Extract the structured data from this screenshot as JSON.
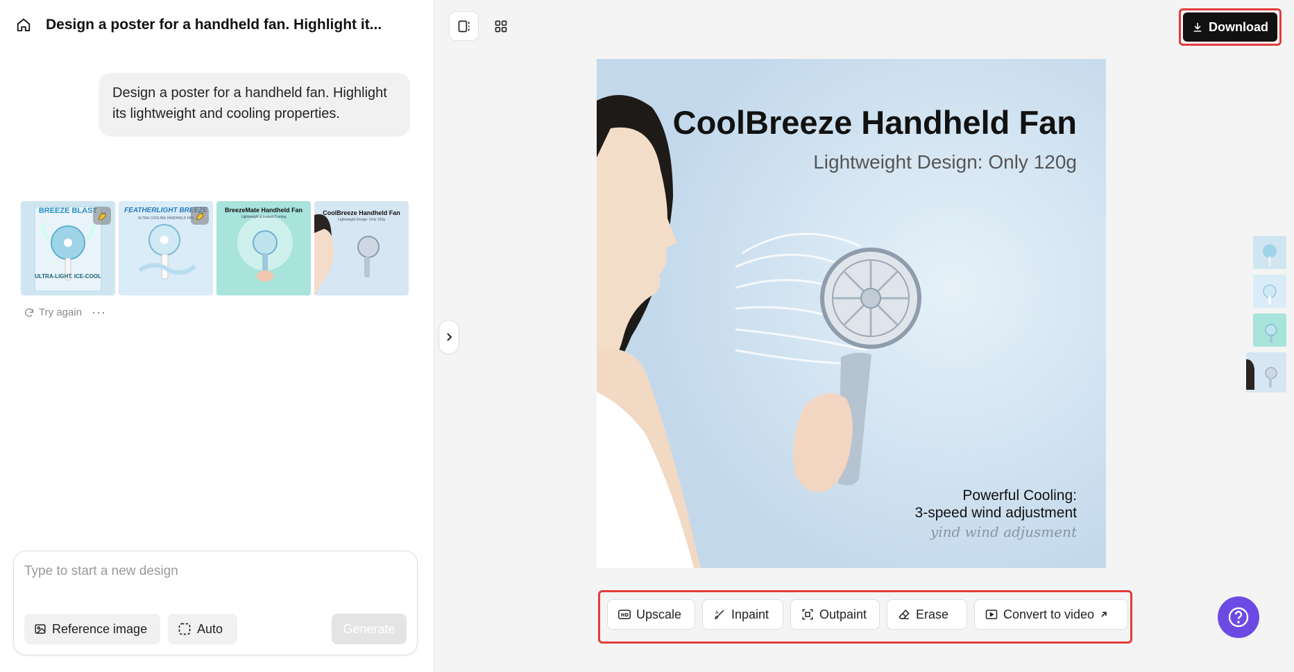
{
  "header": {
    "conversation_title": "Design a poster for a handheld fan. Highlight it..."
  },
  "chat": {
    "user_message": "Design a poster for a handheld fan. Highlight its lightweight and cooling properties.",
    "results": [
      {
        "title": "BREEZE BLAST",
        "subtitle": "ULTRA-LIGHT. ICE-COOL",
        "bg": "#cfe6f2",
        "icon": "hand-edit-icon"
      },
      {
        "title": "FEATHERLIGHT BREEZE",
        "subtitle": "ULTRA-COOLING HANDHELD FAN",
        "bg": "#d9ecf7",
        "icon": "hand-edit-icon"
      },
      {
        "title": "BreezeMate Handheld Fan",
        "subtitle": "Lightweight & Instant Cooling",
        "bg": "#a8e3dc"
      },
      {
        "title": "CoolBreeze Handheld Fan",
        "subtitle": "Lightweight Design: Only 120g",
        "bg": "#d6e6f3"
      }
    ],
    "try_again_label": "Try again",
    "more_label": "···"
  },
  "composer": {
    "placeholder": "Type to start a new design",
    "reference_label": "Reference image",
    "auto_label": "Auto",
    "generate_label": "Generate"
  },
  "toolbar": {
    "download_label": "Download"
  },
  "poster": {
    "title": "CoolBreeze Handheld Fan",
    "subtitle": "Lightweight Design: Only 120g",
    "feature_line1": "Powerful Cooling:",
    "feature_line2": "3-speed wind adjustment",
    "ghost_text": "yind wind adjusment"
  },
  "tools": {
    "upscale": "Upscale",
    "inpaint": "Inpaint",
    "outpaint": "Outpaint",
    "erase": "Erase",
    "convert": "Convert to video"
  },
  "colors": {
    "accent_highlight": "#e33b3b",
    "help_button": "#6c4be4",
    "download_bg": "#111111"
  }
}
